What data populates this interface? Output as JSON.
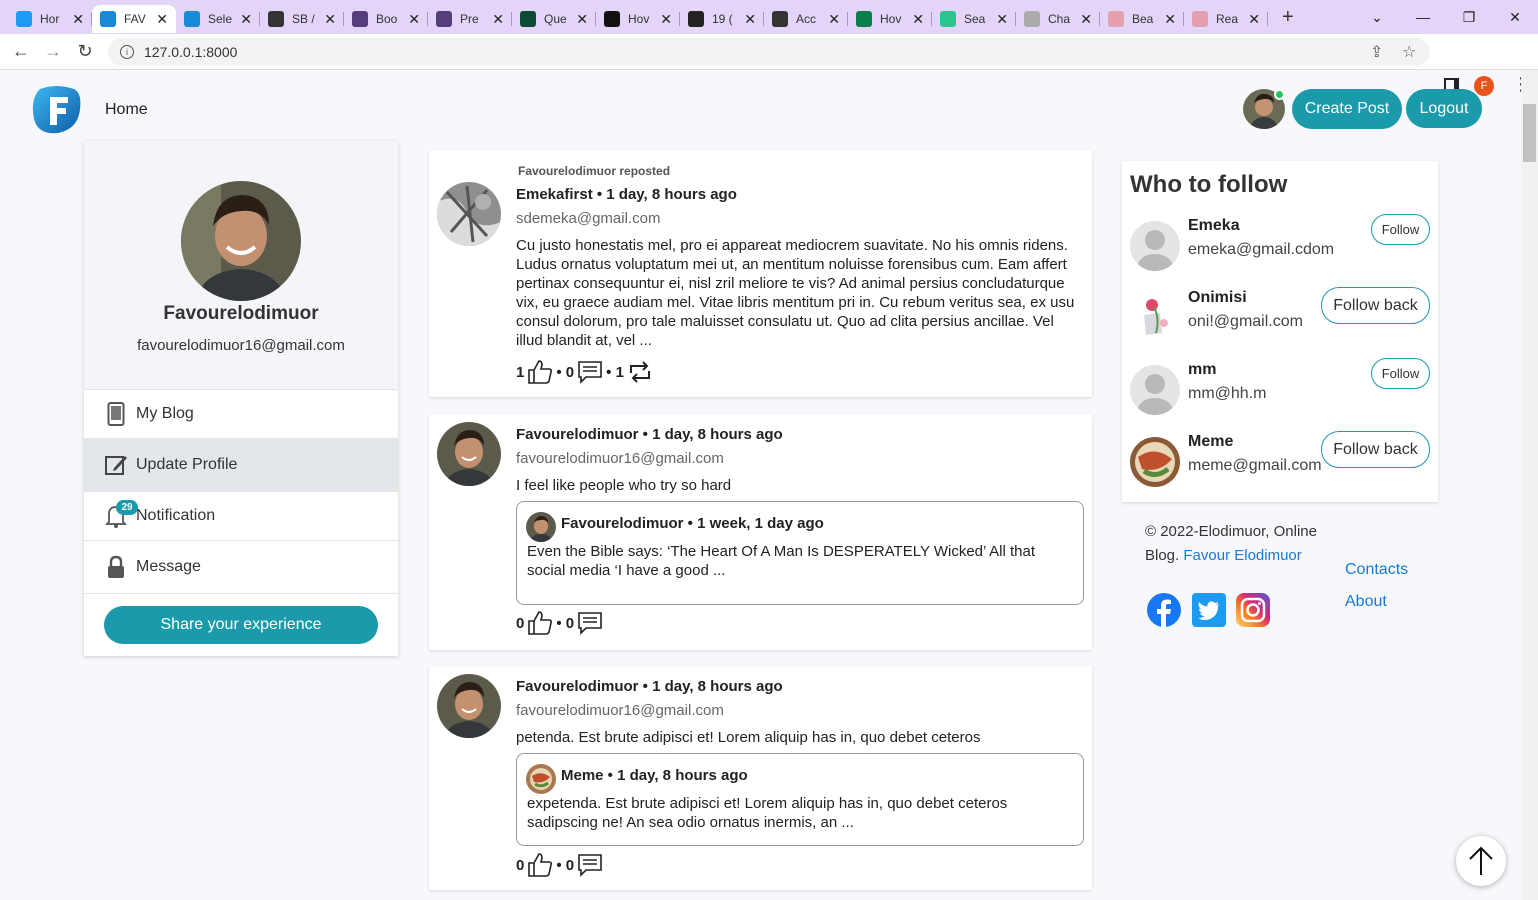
{
  "browser": {
    "tabs": [
      {
        "label": "Hor",
        "icon": "twitter-icon",
        "color": "#1d9bf0"
      },
      {
        "label": "FAV",
        "icon": "f-logo-icon",
        "color": "#1a8ad8",
        "active": true
      },
      {
        "label": "Sele",
        "icon": "f-logo-icon",
        "color": "#1a8ad8"
      },
      {
        "label": "SB /",
        "icon": "globe-icon",
        "color": "#333333"
      },
      {
        "label": "Boo",
        "icon": "bootstrap-icon",
        "color": "#563d7c"
      },
      {
        "label": "Pre",
        "icon": "bootstrap-icon",
        "color": "#563d7c"
      },
      {
        "label": "Que",
        "icon": "django-icon",
        "color": "#0c4b33"
      },
      {
        "label": "Hov",
        "icon": "l-icon",
        "color": "#111111"
      },
      {
        "label": "19 (",
        "icon": "f-icon",
        "color": "#222222"
      },
      {
        "label": "Acc",
        "icon": "globe-icon",
        "color": "#333333"
      },
      {
        "label": "Hov",
        "icon": "w-icon",
        "color": "#0a7d4a"
      },
      {
        "label": "Sea",
        "icon": "v-icon",
        "color": "#2dc58e"
      },
      {
        "label": "Cha",
        "icon": "github-icon",
        "color": "#aaaaaa"
      },
      {
        "label": "Bea",
        "icon": "flower-icon",
        "color": "#e5a0b0"
      },
      {
        "label": "Rea",
        "icon": "flower-icon",
        "color": "#e5a0b0"
      }
    ],
    "url": "127.0.0.1:8000",
    "profile_initial": "F"
  },
  "nav": {
    "home": "Home",
    "create_post": "Create Post",
    "logout": "Logout"
  },
  "profile": {
    "name": "Favourelodimuor",
    "email": "favourelodimuor16@gmail.com"
  },
  "menu": {
    "my_blog": "My Blog",
    "update_profile": "Update Profile",
    "notification": "Notification",
    "notification_count": "29",
    "message": "Message",
    "share": "Share your experience"
  },
  "posts": [
    {
      "repost_label": "Favourelodimuor reposted",
      "author_line": "Emekafirst • 1 day, 8 hours ago",
      "email": "sdemeka@gmail.com",
      "body": "Cu justo honestatis mel, pro ei appareat mediocrem suavitate. No his omnis ridens. Ludus ornatus voluptatum mei ut, an mentitum noluisse forensibus cum. Eam affert pertinax consequuntur ei, nisl zril meliore te vis? Ad animal persius concludaturque vix, eu graece audiam mel. Vitae libris mentitum pri in. Cu rebum veritus sea, ex usu consul dolorum, pro tale maluisset consulatu ut. Quo ad clita persius ancillae. Vel illud blandit at, vel ...",
      "likes": "1",
      "comments": "0",
      "reposts": "1"
    },
    {
      "author_line": "Favourelodimuor • 1 day, 8 hours ago",
      "email": "favourelodimuor16@gmail.com",
      "body": "I feel like people who try so hard",
      "quote": {
        "author_line": "Favourelodimuor • 1 week, 1 day ago",
        "body": "Even the Bible says: ‘The Heart Of A Man Is DESPERATELY Wicked’ All that social media ‘I have a good ..."
      },
      "likes": "0",
      "comments": "0"
    },
    {
      "author_line": "Favourelodimuor • 1 day, 8 hours ago",
      "email": "favourelodimuor16@gmail.com",
      "body": "petenda. Est brute adipisci et! Lorem aliquip has in, quo debet ceteros",
      "quote": {
        "author_line": "Meme • 1 day, 8 hours ago",
        "body": "expetenda. Est brute adipisci et! Lorem aliquip has in, quo debet ceteros sadipscing ne! An sea odio ornatus inermis, an ..."
      },
      "likes": "0",
      "comments": "0"
    }
  ],
  "who_to_follow": {
    "title": "Who to follow",
    "users": [
      {
        "name": "Emeka",
        "email": "emeka@gmail.cdom",
        "button": "Follow"
      },
      {
        "name": "Onimisi",
        "email": "oni!@gmail.com",
        "button": "Follow back"
      },
      {
        "name": "mm",
        "email": "mm@hh.m",
        "button": "Follow"
      },
      {
        "name": "Meme",
        "email": "meme@gmail.com",
        "button": "Follow back"
      }
    ]
  },
  "footer": {
    "copyright": "© 2022-Elodimuor, Online Blog.",
    "author_link": "Favour Elodimuor",
    "contacts": "Contacts",
    "about": "About"
  },
  "colors": {
    "accent": "#1a9aab",
    "link": "#1a7ad4",
    "tabbar": "#e3d5f7"
  }
}
